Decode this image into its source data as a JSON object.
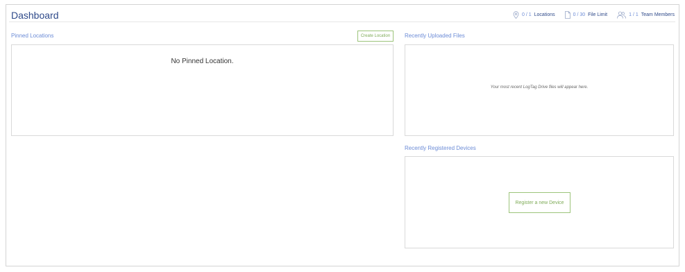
{
  "header": {
    "title": "Dashboard",
    "stats": [
      {
        "icon": "location-pin-icon",
        "count": "0 / 1",
        "unit": "Locations"
      },
      {
        "icon": "file-icon",
        "count": "0 / 30",
        "unit": "File Limit"
      },
      {
        "icon": "team-members-icon",
        "count": "1 / 1",
        "unit": "Team Members"
      }
    ]
  },
  "pinned": {
    "label": "Pinned Locations",
    "create_button": "Create Location",
    "empty_text": "No Pinned Location."
  },
  "files": {
    "label": "Recently Uploaded Files",
    "empty_text": "Your most recent LogTag Drive files will appear here."
  },
  "devices": {
    "label": "Recently Registered Devices",
    "register_button": "Register a new Device"
  },
  "colors": {
    "title": "#2f4a8a",
    "label": "#6b8bd6",
    "accent_green": "#7eab57"
  }
}
